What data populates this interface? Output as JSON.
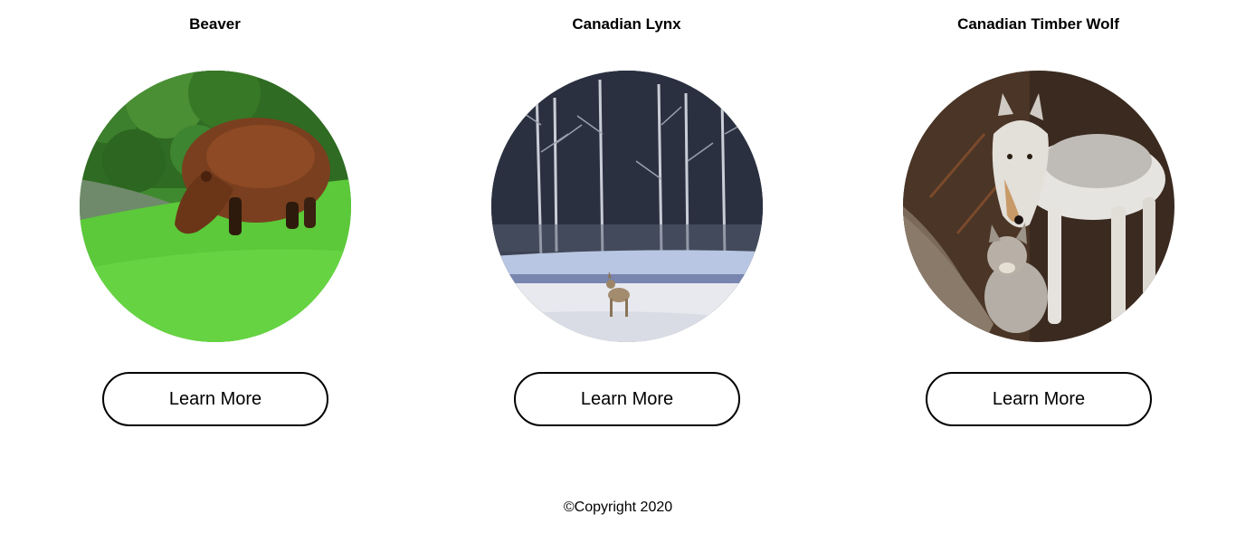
{
  "cards": [
    {
      "title": "Beaver",
      "image_icon": "capybara-grazing-photo",
      "button_label": "Learn More"
    },
    {
      "title": "Canadian Lynx",
      "image_icon": "coyote-in-snowy-forest-photo",
      "button_label": "Learn More"
    },
    {
      "title": "Canadian Timber Wolf",
      "image_icon": "wolf-with-pup-photo",
      "button_label": "Learn More"
    }
  ],
  "footer": {
    "copyright": "©Copyright 2020"
  }
}
